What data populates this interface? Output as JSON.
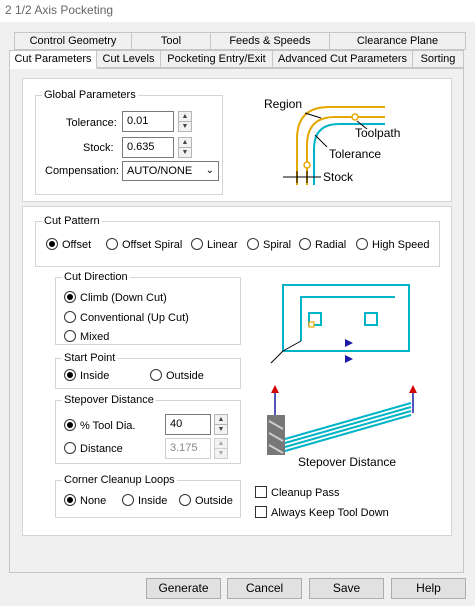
{
  "window": {
    "title": "2 1/2 Axis Pocketing"
  },
  "tabs_row1": [
    {
      "label": "Control Geometry"
    },
    {
      "label": "Tool"
    },
    {
      "label": "Feeds & Speeds"
    },
    {
      "label": "Clearance Plane"
    }
  ],
  "tabs_row2": [
    {
      "label": "Cut Parameters"
    },
    {
      "label": "Cut Levels"
    },
    {
      "label": "Pocketing Entry/Exit"
    },
    {
      "label": "Advanced Cut Parameters"
    },
    {
      "label": "Sorting"
    }
  ],
  "global_parameters": {
    "title": "Global Parameters",
    "tolerance_label": "Tolerance:",
    "tolerance_value": "0.01",
    "stock_label": "Stock:",
    "stock_value": "0.635",
    "compensation_label": "Compensation:",
    "compensation_value": "AUTO/NONE"
  },
  "diagram_top": {
    "region": "Region",
    "toolpath": "Toolpath",
    "tolerance": "Tolerance",
    "stock": "Stock"
  },
  "cut_pattern": {
    "title": "Cut Pattern",
    "options": [
      "Offset",
      "Offset Spiral",
      "Linear",
      "Spiral",
      "Radial",
      "High Speed"
    ],
    "selected": "Offset"
  },
  "cut_direction": {
    "title": "Cut Direction",
    "options": [
      "Climb (Down Cut)",
      "Conventional (Up Cut)",
      "Mixed"
    ],
    "selected": "Climb (Down Cut)"
  },
  "start_point": {
    "title": "Start Point",
    "options": [
      "Inside",
      "Outside"
    ],
    "selected": "Inside"
  },
  "stepover_distance": {
    "title": "Stepover Distance",
    "tool_dia_label": "% Tool Dia.",
    "tool_dia_value": "40",
    "distance_label": "Distance",
    "distance_value": "3.175",
    "selected": "% Tool Dia."
  },
  "diagram_bottom": {
    "stepover_label": "Stepover Distance"
  },
  "corner_cleanup": {
    "title": "Corner Cleanup Loops",
    "options": [
      "None",
      "Inside",
      "Outside"
    ],
    "selected": "None"
  },
  "checkboxes": {
    "cleanup_pass": "Cleanup Pass",
    "always_keep_tool_down": "Always Keep Tool Down"
  },
  "buttons": {
    "generate": "Generate",
    "cancel": "Cancel",
    "save": "Save",
    "help": "Help"
  },
  "colors": {
    "accent_cyan": "#00b4c8",
    "accent_gold": "#e6a800",
    "arrow_blue": "#1a1aa6"
  }
}
